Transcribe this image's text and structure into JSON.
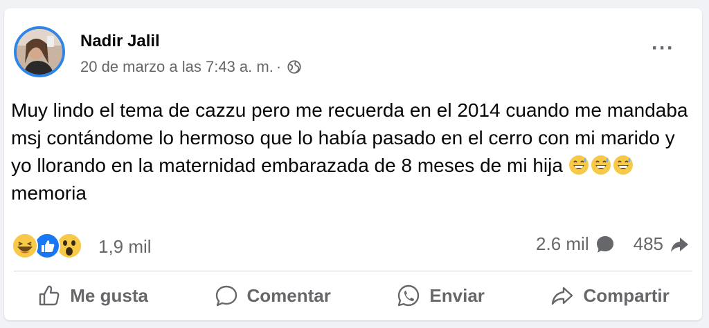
{
  "post": {
    "author": "Nadir Jalil",
    "timestamp": "20 de marzo a las 7:43 a. m.",
    "separator": "·",
    "privacy_icon": "globe-icon",
    "more_label": "···",
    "text_main": "Muy lindo el tema de cazzu pero me recuerda en el 2014 cuando me mandaba msj contándome lo hermoso que lo había pasado en el cerro con mi marido y yo llorando en la maternidad embarazada de 8 meses de mi hija",
    "text_tail": "memoria",
    "emojis": [
      "grinning-sweat-emoji",
      "grinning-sweat-emoji",
      "grinning-sweat-emoji"
    ]
  },
  "reactions": {
    "icons": [
      "haha-reaction-icon",
      "like-reaction-icon",
      "wow-reaction-icon"
    ],
    "count": "1,9 mil",
    "comments_count": "2.6 mil",
    "shares_count": "485"
  },
  "actions": {
    "like_label": "Me gusta",
    "comment_label": "Comentar",
    "send_label": "Enviar",
    "share_label": "Compartir"
  },
  "colors": {
    "accent": "#2f86e6",
    "text": "#050505",
    "muted": "#65676b",
    "like_blue": "#1877f2",
    "emoji_yellow": "#f7c948"
  }
}
